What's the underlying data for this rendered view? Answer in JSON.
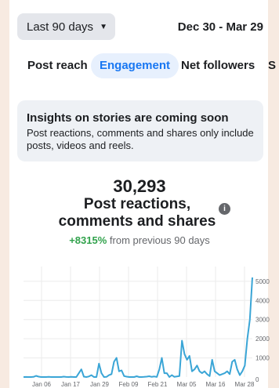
{
  "header": {
    "range_label": "Last 90 days",
    "date_range": "Dec 30 - Mar 29"
  },
  "tabs": [
    {
      "label": "Post reach",
      "active": false
    },
    {
      "label": "Engagement",
      "active": true
    },
    {
      "label": "Net followers",
      "active": false
    },
    {
      "label": "S",
      "active": false
    }
  ],
  "notice": {
    "title": "Insights on stories are coming soon",
    "body": "Post reactions, comments and shares only include posts, videos and reels."
  },
  "metric": {
    "value": "30,293",
    "label": "Post reactions, comments and shares",
    "change_pct": "+8315%",
    "change_text": " from previous 90 days"
  },
  "colors": {
    "accent": "#1877f2",
    "positive": "#31a24c",
    "line": "#3aa5d6"
  },
  "chart_data": {
    "type": "line",
    "x_tick_labels": [
      "Jan 06",
      "Jan 17",
      "Jan 29",
      "Feb 09",
      "Feb 21",
      "Mar 05",
      "Mar 16",
      "Mar 28"
    ],
    "y_ticks": [
      0,
      1000,
      2000,
      3000,
      4000,
      5000
    ],
    "ylim": [
      0,
      5200
    ],
    "grid": true,
    "series": [
      {
        "values": [
          0,
          5,
          0,
          0,
          10,
          60,
          20,
          0,
          0,
          0,
          10,
          0,
          0,
          0,
          0,
          0,
          20,
          5,
          0,
          10,
          0,
          0,
          200,
          400,
          20,
          0,
          30,
          100,
          0,
          0,
          700,
          200,
          0,
          10,
          100,
          150,
          800,
          1000,
          300,
          350,
          50,
          20,
          0,
          0,
          0,
          40,
          0,
          0,
          10,
          20,
          40,
          10,
          30,
          5,
          400,
          1000,
          200,
          200,
          0,
          100,
          10,
          30,
          50,
          1900,
          1200,
          900,
          1100,
          300,
          400,
          600,
          300,
          200,
          300,
          150,
          50,
          900,
          300,
          200,
          100,
          150,
          200,
          300,
          150,
          800,
          900,
          400,
          100,
          300,
          600,
          2000,
          3000,
          5200
        ]
      }
    ]
  }
}
